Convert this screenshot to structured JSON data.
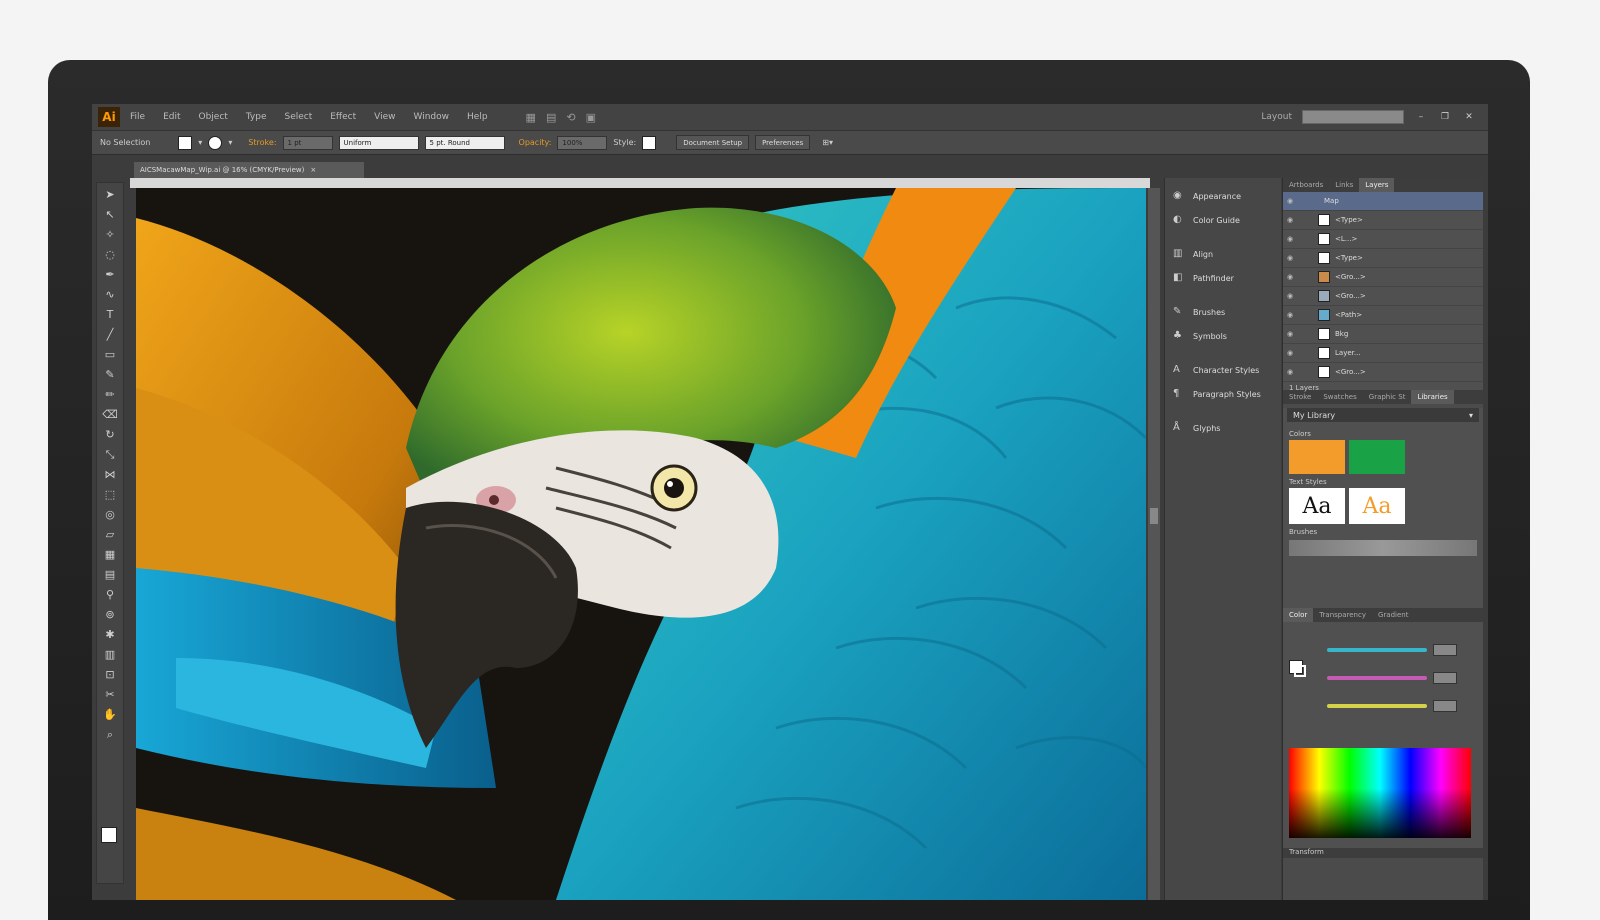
{
  "app": {
    "logo": "Ai"
  },
  "menu": [
    "File",
    "Edit",
    "Object",
    "Type",
    "Select",
    "Effect",
    "View",
    "Window",
    "Help"
  ],
  "window": {
    "workspace": "Layout",
    "controls": [
      "–",
      "❐",
      "✕"
    ]
  },
  "control_bar": {
    "selection": "No Selection",
    "stroke_label": "Stroke:",
    "stroke_value": "1 pt",
    "brush_style": "Uniform",
    "brush_def": "5 pt. Round",
    "opacity_label": "Opacity:",
    "opacity_value": "100%",
    "style_label": "Style:",
    "doc_setup": "Document Setup",
    "preferences": "Preferences"
  },
  "doc_tab": {
    "title": "AICSMacawMap_Wip.ai @ 16% (CMYK/Preview)",
    "close": "×"
  },
  "dock": [
    "Appearance",
    "Color Guide",
    "Align",
    "Pathfinder",
    "Brushes",
    "Symbols",
    "Character Styles",
    "Paragraph Styles",
    "Glyphs"
  ],
  "layers_panel": {
    "tabs": [
      "Artboards",
      "Links",
      "Layers"
    ],
    "rows": [
      "Map",
      "<Type>",
      "<L...>",
      "<Type>",
      "<Gro...>",
      "<Gro...>",
      "<Path>",
      "Bkg",
      "Layer...",
      "<Gro...>",
      "<Gro...>"
    ],
    "footer": "1 Layers"
  },
  "library_panel": {
    "tabs": [
      "Stroke",
      "Swatches",
      "Graphic St",
      "Libraries"
    ],
    "selected": "My Library",
    "colors_label": "Colors",
    "text_styles_label": "Text Styles",
    "brushes_label": "Brushes",
    "colors": [
      "#f39c2b",
      "#1aa346"
    ],
    "text_sample": "Aa"
  },
  "color_panel": {
    "tabs": [
      "Color",
      "Transparency",
      "Gradient"
    ],
    "transform_tab": "Transform",
    "slider_colors": [
      "#37b5c9",
      "#c65bb6",
      "#d6d14a"
    ]
  }
}
